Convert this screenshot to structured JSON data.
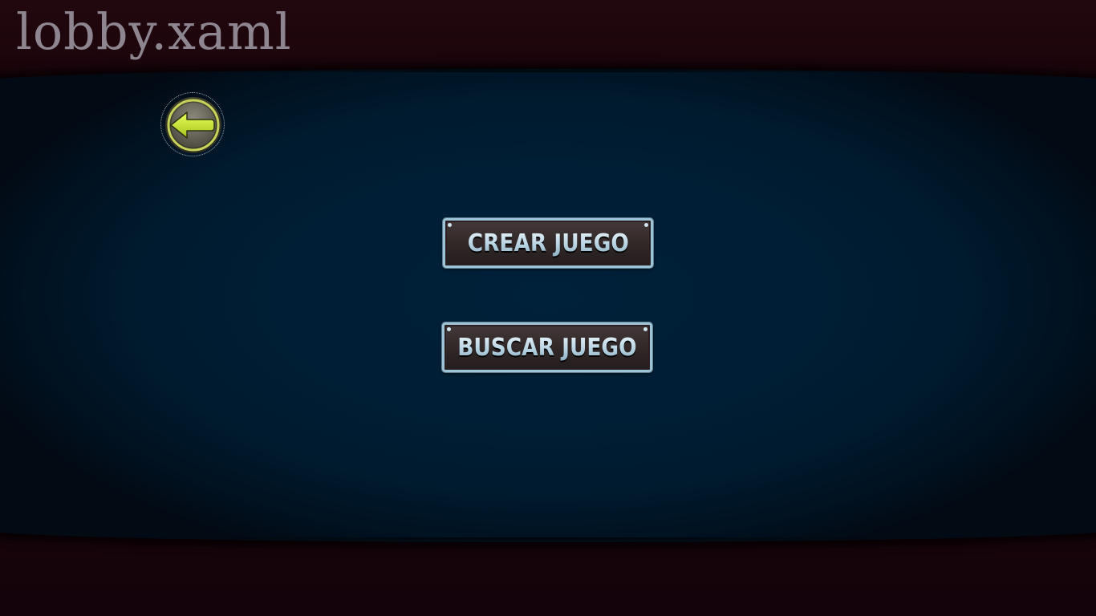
{
  "window": {
    "title": "lobby.xaml"
  },
  "back_button": {
    "icon": "arrow-left-icon",
    "accent_color": "#c8e63a"
  },
  "menu": {
    "create_game_label": "CREAR JUEGO",
    "find_game_label": "BUSCAR JUEGO"
  },
  "colors": {
    "background": "#1a050b",
    "stage": "#001e35",
    "button_border": "#9dc3d6",
    "button_text": "#b8d5e3"
  }
}
